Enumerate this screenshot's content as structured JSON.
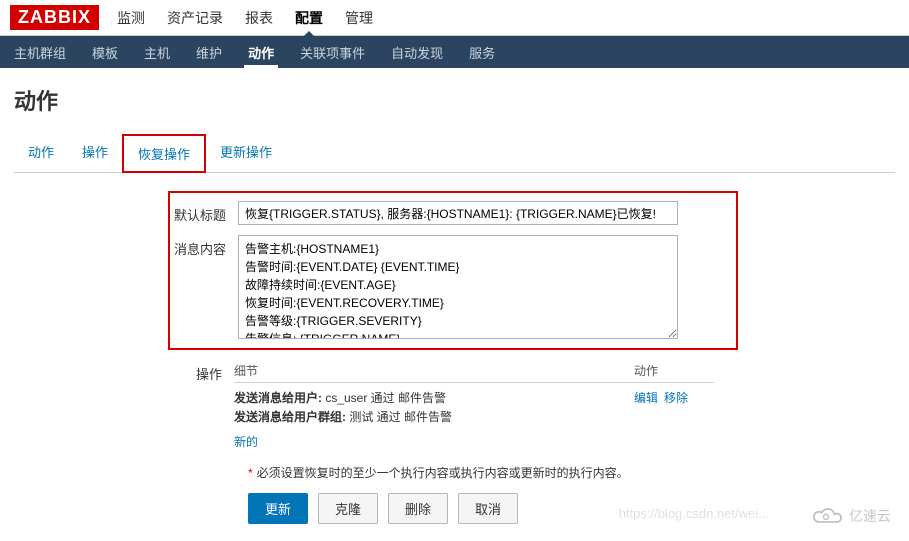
{
  "logo": "ZABBIX",
  "top_nav": {
    "items": [
      "监测",
      "资产记录",
      "报表",
      "配置",
      "管理"
    ],
    "active": "配置"
  },
  "sub_nav": {
    "items": [
      "主机群组",
      "模板",
      "主机",
      "维护",
      "动作",
      "关联项事件",
      "自动发现",
      "服务"
    ],
    "active": "动作"
  },
  "page_title": "动作",
  "tabs": {
    "items": [
      "动作",
      "操作",
      "恢复操作",
      "更新操作"
    ],
    "boxed": "恢复操作"
  },
  "form": {
    "title_label": "默认标题",
    "title_value": "恢复{TRIGGER.STATUS}, 服务器:{HOSTNAME1}: {TRIGGER.NAME}已恢复!",
    "message_label": "消息内容",
    "message_value": "告警主机:{HOSTNAME1}\n告警时间:{EVENT.DATE} {EVENT.TIME}\n故障持续时间:{EVENT.AGE}\n恢复时间:{EVENT.RECOVERY.TIME}\n告警等级:{TRIGGER.SEVERITY}\n告警信息: {TRIGGER.NAME}"
  },
  "operations": {
    "label": "操作",
    "header_detail": "细节",
    "header_action": "动作",
    "rows": [
      {
        "b": "发送消息给用户:",
        "t": " cs_user 通过 邮件告警"
      },
      {
        "b": "发送消息给用户群组:",
        "t": " 测试 通过 邮件告警"
      }
    ],
    "edit": "编辑",
    "remove": "移除",
    "new": "新的"
  },
  "warning": "必须设置恢复时的至少一个执行内容或执行内容或更新时的执行内容。",
  "buttons": {
    "update": "更新",
    "clone": "克隆",
    "delete": "删除",
    "cancel": "取消"
  },
  "watermark": {
    "url": "https://blog.csdn.net/wei...",
    "brand": "亿速云"
  }
}
